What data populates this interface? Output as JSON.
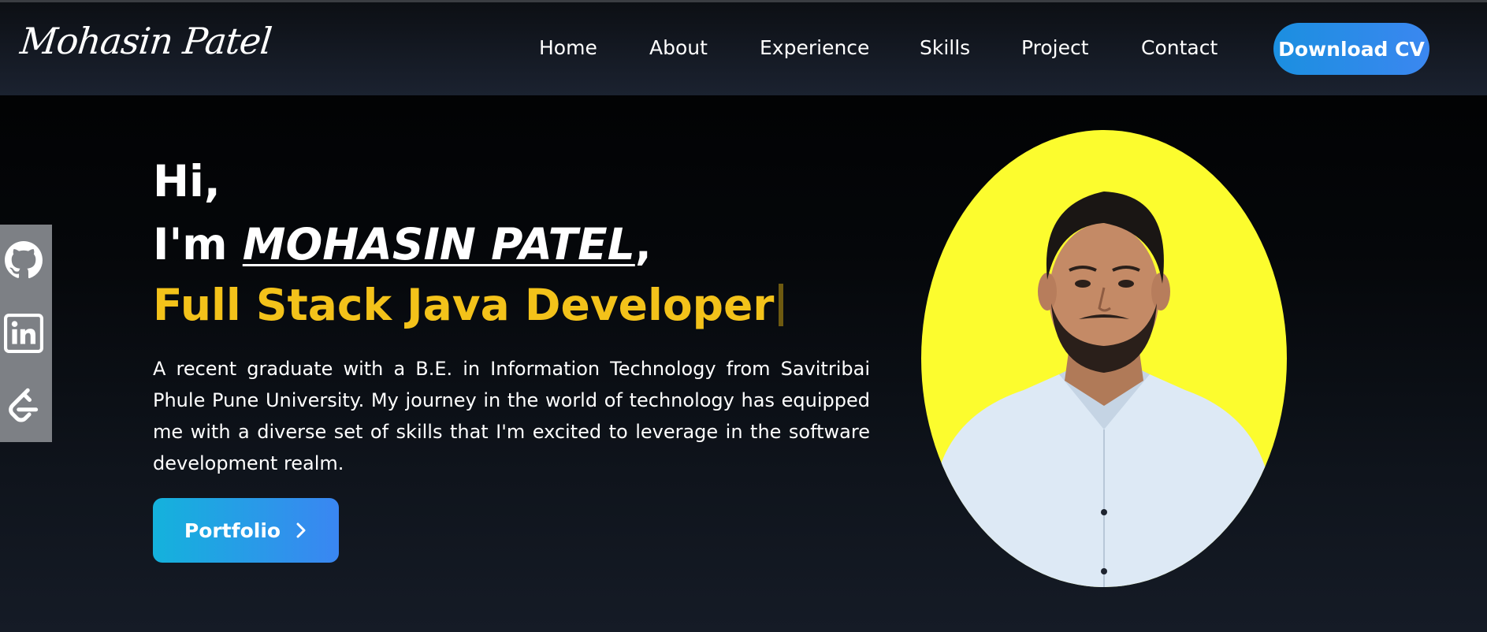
{
  "brand": {
    "name": "Mohasin Patel"
  },
  "nav": {
    "links": [
      "Home",
      "About",
      "Experience",
      "Skills",
      "Project",
      "Contact"
    ],
    "download_label": "Download CV"
  },
  "social": {
    "icons": [
      "github-icon",
      "linkedin-icon",
      "leetcode-icon"
    ]
  },
  "hero": {
    "greeting": "Hi,",
    "intro_prefix": "I'm ",
    "name": "MOHASIN PATEL",
    "intro_suffix": ",",
    "role": "Full Stack Java Developer",
    "bio": "A recent graduate with a B.E. in Information Technology from Savitribai Phule Pune University. My journey in the world of technology has equipped me with a diverse set of skills that I'm excited to leverage in the software development realm.",
    "portfolio_label": "Portfolio"
  },
  "colors": {
    "accent_yellow": "#f3c21a",
    "button_blue": "#3b87f0",
    "portrait_bg": "#fcfc2e"
  }
}
